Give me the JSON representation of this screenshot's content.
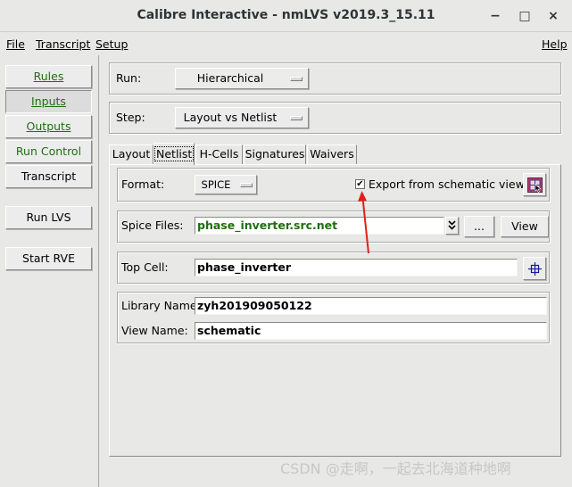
{
  "window": {
    "title": "Calibre Interactive - nmLVS v2019.3_15.11",
    "controls": [
      "−",
      "□",
      "×"
    ]
  },
  "menu": {
    "file": "File",
    "transcript": "Transcript",
    "setup": "Setup",
    "help": "Help"
  },
  "nav": {
    "rules": "Rules",
    "inputs": "Inputs",
    "outputs": "Outputs",
    "run_control": "Run Control",
    "transcript": "Transcript",
    "run_lvs": "Run LVS",
    "start_rve": "Start RVE",
    "active_item": "Inputs",
    "green_color": "#1f6e10"
  },
  "run": {
    "label": "Run:",
    "value": "Hierarchical"
  },
  "step": {
    "label": "Step:",
    "value": "Layout vs Netlist"
  },
  "tabs": [
    {
      "label": "Layout"
    },
    {
      "label": "Netlist"
    },
    {
      "label": "H-Cells"
    },
    {
      "label": "Signatures"
    },
    {
      "label": "Waivers"
    }
  ],
  "active_tab": "Netlist",
  "netlist": {
    "format_label": "Format:",
    "format_value": "SPICE",
    "export_checked": true,
    "export_check_mark": "✔",
    "export_label": "Export from schematic viewer",
    "spice_files_label": "Spice Files:",
    "spice_files_value": "phase_inverter.src.net",
    "browse_label": "...",
    "view_label": "View",
    "top_cell_label": "Top Cell:",
    "top_cell_value": "phase_inverter",
    "library_name_label": "Library Name:",
    "library_name_value": "zyh201909050122",
    "view_name_label": "View Name:",
    "view_name_value": "schematic"
  },
  "annotation": {
    "arrow_color": "#e0201c"
  },
  "watermark": "CSDN @走啊，一起去北海道种地啊"
}
